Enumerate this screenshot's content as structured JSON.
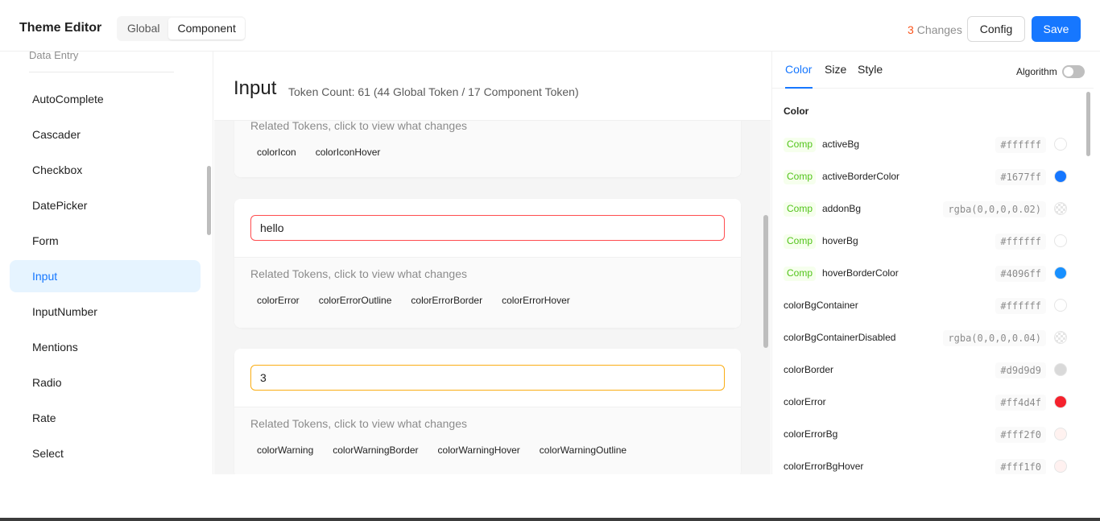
{
  "header": {
    "title": "Theme Editor",
    "segments": [
      "Global",
      "Component"
    ],
    "changes_count": "3",
    "changes_label": "Changes",
    "config_label": "Config",
    "save_label": "Save"
  },
  "sidebar": {
    "group": "Data Entry",
    "items": [
      "AutoComplete",
      "Cascader",
      "Checkbox",
      "DatePicker",
      "Form",
      "Input",
      "InputNumber",
      "Mentions",
      "Radio",
      "Rate",
      "Select"
    ],
    "active": "Input"
  },
  "main": {
    "title": "Input",
    "token_count": "Token Count: 61 (44 Global Token / 17 Component Token)",
    "related_label": "Related Tokens, click to view what changes",
    "cards": [
      {
        "tokens": [
          "colorIcon",
          "colorIconHover"
        ]
      },
      {
        "input_value": "hello",
        "status": "error",
        "tokens": [
          "colorError",
          "colorErrorOutline",
          "colorErrorBorder",
          "colorErrorHover"
        ]
      },
      {
        "input_value": "3",
        "status": "warning",
        "tokens": [
          "colorWarning",
          "colorWarningBorder",
          "colorWarningHover",
          "colorWarningOutline"
        ]
      }
    ]
  },
  "right_panel": {
    "tabs": [
      "Color",
      "Size",
      "Style"
    ],
    "algorithm_label": "Algorithm",
    "section_title": "Color",
    "comp_tag": "Comp",
    "tokens": [
      {
        "name": "activeBg",
        "value": "#ffffff",
        "comp": true,
        "swatch": "#ffffff"
      },
      {
        "name": "activeBorderColor",
        "value": "#1677ff",
        "comp": true,
        "swatch": "#1677ff"
      },
      {
        "name": "addonBg",
        "value": "rgba(0,0,0,0.02)",
        "comp": true,
        "swatch": "checker"
      },
      {
        "name": "hoverBg",
        "value": "#ffffff",
        "comp": true,
        "swatch": "#ffffff"
      },
      {
        "name": "hoverBorderColor",
        "value": "#4096ff",
        "comp": true,
        "swatch": "#1890ff"
      },
      {
        "name": "colorBgContainer",
        "value": "#ffffff",
        "comp": false,
        "swatch": "#ffffff"
      },
      {
        "name": "colorBgContainerDisabled",
        "value": "rgba(0,0,0,0.04)",
        "comp": false,
        "swatch": "checker"
      },
      {
        "name": "colorBorder",
        "value": "#d9d9d9",
        "comp": false,
        "swatch": "#d9d9d9"
      },
      {
        "name": "colorError",
        "value": "#ff4d4f",
        "comp": false,
        "swatch": "#f5222d"
      },
      {
        "name": "colorErrorBg",
        "value": "#fff2f0",
        "comp": false,
        "swatch": "#fff2f0"
      },
      {
        "name": "colorErrorBgHover",
        "value": "#fff1f0",
        "comp": false,
        "swatch": "#fff1f0"
      }
    ]
  }
}
